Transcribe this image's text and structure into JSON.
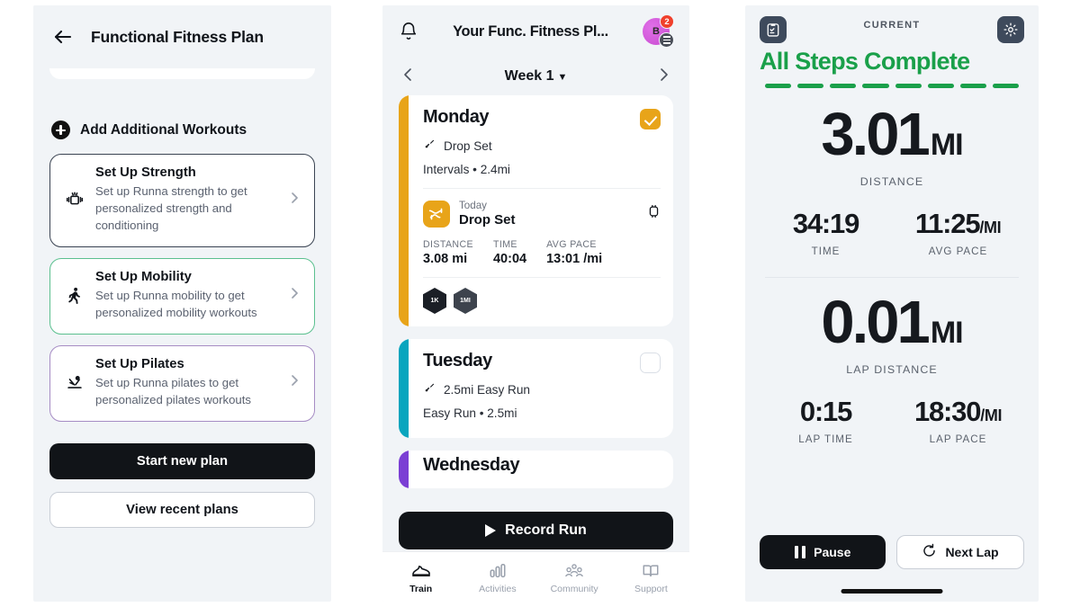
{
  "panel1": {
    "header": {
      "back_icon": "arrow-left-icon",
      "title": "Functional Fitness Plan"
    },
    "add_row": {
      "icon": "plus-circle-icon",
      "label": "Add Additional Workouts"
    },
    "option_cards": [
      {
        "title": "Set Up Strength",
        "desc": "Set up Runna strength to get personalized strength and conditioning",
        "icon": "dumbbell-icon",
        "border_color": "#3b4453",
        "chevron": "chevron-right-icon"
      },
      {
        "title": "Set Up Mobility",
        "desc": "Set up Runna mobility to get personalized mobility workouts",
        "icon": "runner-icon",
        "border_color": "#5bc08f",
        "chevron": "chevron-right-icon"
      },
      {
        "title": "Set Up Pilates",
        "desc": "Set up Runna pilates to get personalized pilates workouts",
        "icon": "pilates-icon",
        "border_color": "#a68cc4",
        "chevron": "chevron-right-icon"
      }
    ],
    "primary_button": "Start new plan",
    "secondary_button": "View recent plans"
  },
  "panel2": {
    "header": {
      "bell_icon": "bell-icon",
      "title": "Your Func. Fitness Pl...",
      "avatar_initial": "B",
      "avatar_badge_count": "2",
      "avatar_color": "#c84ad0",
      "badge_color": "#f0402c"
    },
    "week_nav": {
      "prev_icon": "chevron-left-icon",
      "label": "Week 1",
      "caret": "▼",
      "next_icon": "chevron-right-icon"
    },
    "days": [
      {
        "name": "Monday",
        "stripe_color": "#e8a419",
        "completed": true,
        "workout_icon": "shoe-speed-icon",
        "workout_title": "Drop Set",
        "meta": "Intervals • 2.4mi",
        "activity": {
          "when": "Today",
          "name": "Drop Set",
          "thumb_icon": "workout-thumb-icon",
          "device_icon": "watch-icon",
          "stats": [
            {
              "key": "DISTANCE",
              "value": "3.08 mi"
            },
            {
              "key": "TIME",
              "value": "40:04"
            },
            {
              "key": "AVG PACE",
              "value": "13:01 /mi"
            }
          ],
          "badges": [
            "1K",
            "1MI"
          ]
        }
      },
      {
        "name": "Tuesday",
        "stripe_color": "#09a5be",
        "completed": false,
        "workout_icon": "shoe-speed-icon",
        "workout_title": "2.5mi Easy Run",
        "meta": "Easy Run • 2.5mi"
      },
      {
        "name": "Wednesday",
        "stripe_color": "#7b3fd4",
        "completed": false
      }
    ],
    "record_button": {
      "label": "Record Run",
      "icon": "play-icon"
    },
    "tabs": [
      {
        "label": "Train",
        "icon": "shoe-icon",
        "active": true
      },
      {
        "label": "Activities",
        "icon": "bar-chart-icon",
        "active": false
      },
      {
        "label": "Community",
        "icon": "people-icon",
        "active": false
      },
      {
        "label": "Support",
        "icon": "book-icon",
        "active": false
      }
    ]
  },
  "panel3": {
    "top_left_icon": "clipboard-check-icon",
    "top_right_icon": "gear-icon",
    "kicker": "CURRENT",
    "status": "All Steps Complete",
    "status_color": "#1aa04a",
    "step_dashes": 8,
    "distance": {
      "value": "3.01",
      "unit": "MI",
      "label": "DISTANCE"
    },
    "time": {
      "value": "34:19",
      "label": "TIME"
    },
    "avg_pace": {
      "value": "11:25",
      "unit": "/MI",
      "label": "AVG PACE"
    },
    "lap_distance": {
      "value": "0.01",
      "unit": "MI",
      "label": "LAP DISTANCE"
    },
    "lap_time": {
      "value": "0:15",
      "label": "LAP TIME"
    },
    "lap_pace": {
      "value": "18:30",
      "unit": "/MI",
      "label": "LAP PACE"
    },
    "pause_button": {
      "label": "Pause",
      "icon": "pause-icon"
    },
    "next_lap_button": {
      "label": "Next Lap",
      "icon": "refresh-icon"
    }
  }
}
